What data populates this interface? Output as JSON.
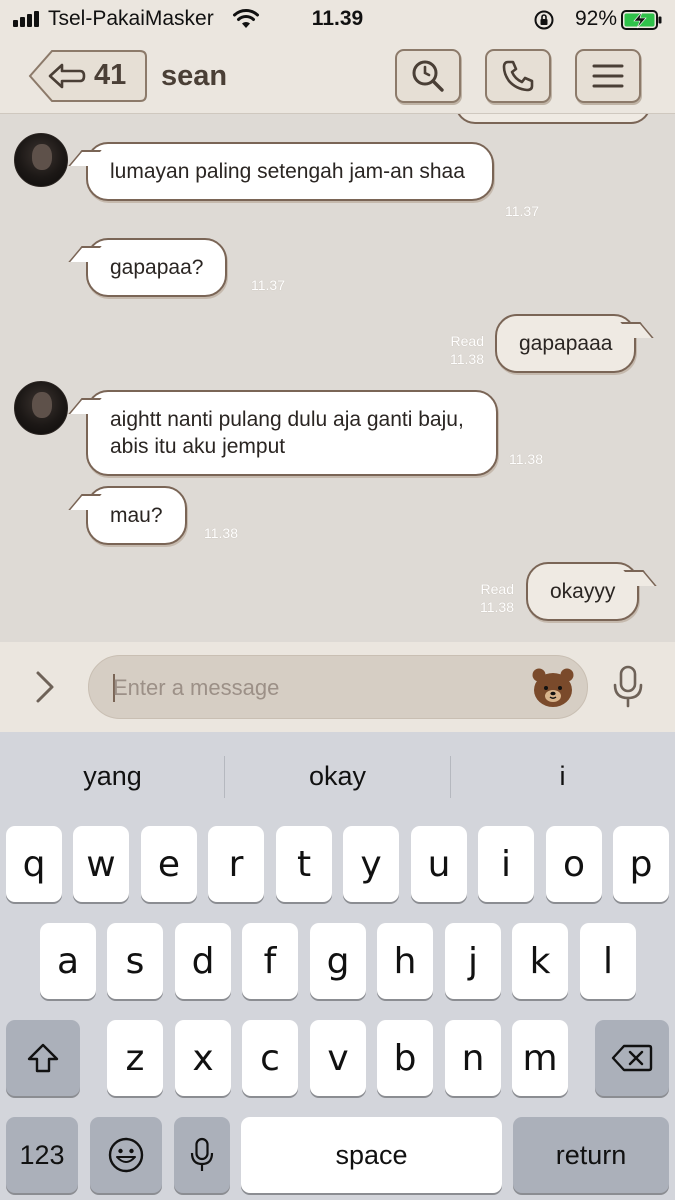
{
  "status_bar": {
    "carrier": "Tsel-PakaiMasker",
    "time": "11.39",
    "battery_percent": "92%"
  },
  "header": {
    "back_count": "41",
    "contact_name": "sean"
  },
  "messages": [
    {
      "direction": "in",
      "text": "lumayan paling setengah jam-an shaa",
      "time": "11.37"
    },
    {
      "direction": "in",
      "text": "gapapaa?",
      "time": "11.37"
    },
    {
      "direction": "out",
      "text": "gapapaaa",
      "status": "Read",
      "time": "11.38"
    },
    {
      "direction": "in",
      "text": "aightt nanti pulang dulu aja ganti baju, abis itu aku jemput",
      "time": "11.38"
    },
    {
      "direction": "in",
      "text": "mau?",
      "time": "11.38"
    },
    {
      "direction": "out",
      "text": "okayyy",
      "status": "Read",
      "time": "11.38"
    }
  ],
  "input": {
    "placeholder": "Enter a message"
  },
  "keyboard": {
    "suggestions": [
      "yang",
      "okay",
      "i"
    ],
    "row1": [
      "q",
      "w",
      "e",
      "r",
      "t",
      "y",
      "u",
      "i",
      "o",
      "p"
    ],
    "row2": [
      "a",
      "s",
      "d",
      "f",
      "g",
      "h",
      "j",
      "k",
      "l"
    ],
    "row3": [
      "z",
      "x",
      "c",
      "v",
      "b",
      "n",
      "m"
    ],
    "numbers_key": "123",
    "space_key": "space",
    "return_key": "return"
  }
}
